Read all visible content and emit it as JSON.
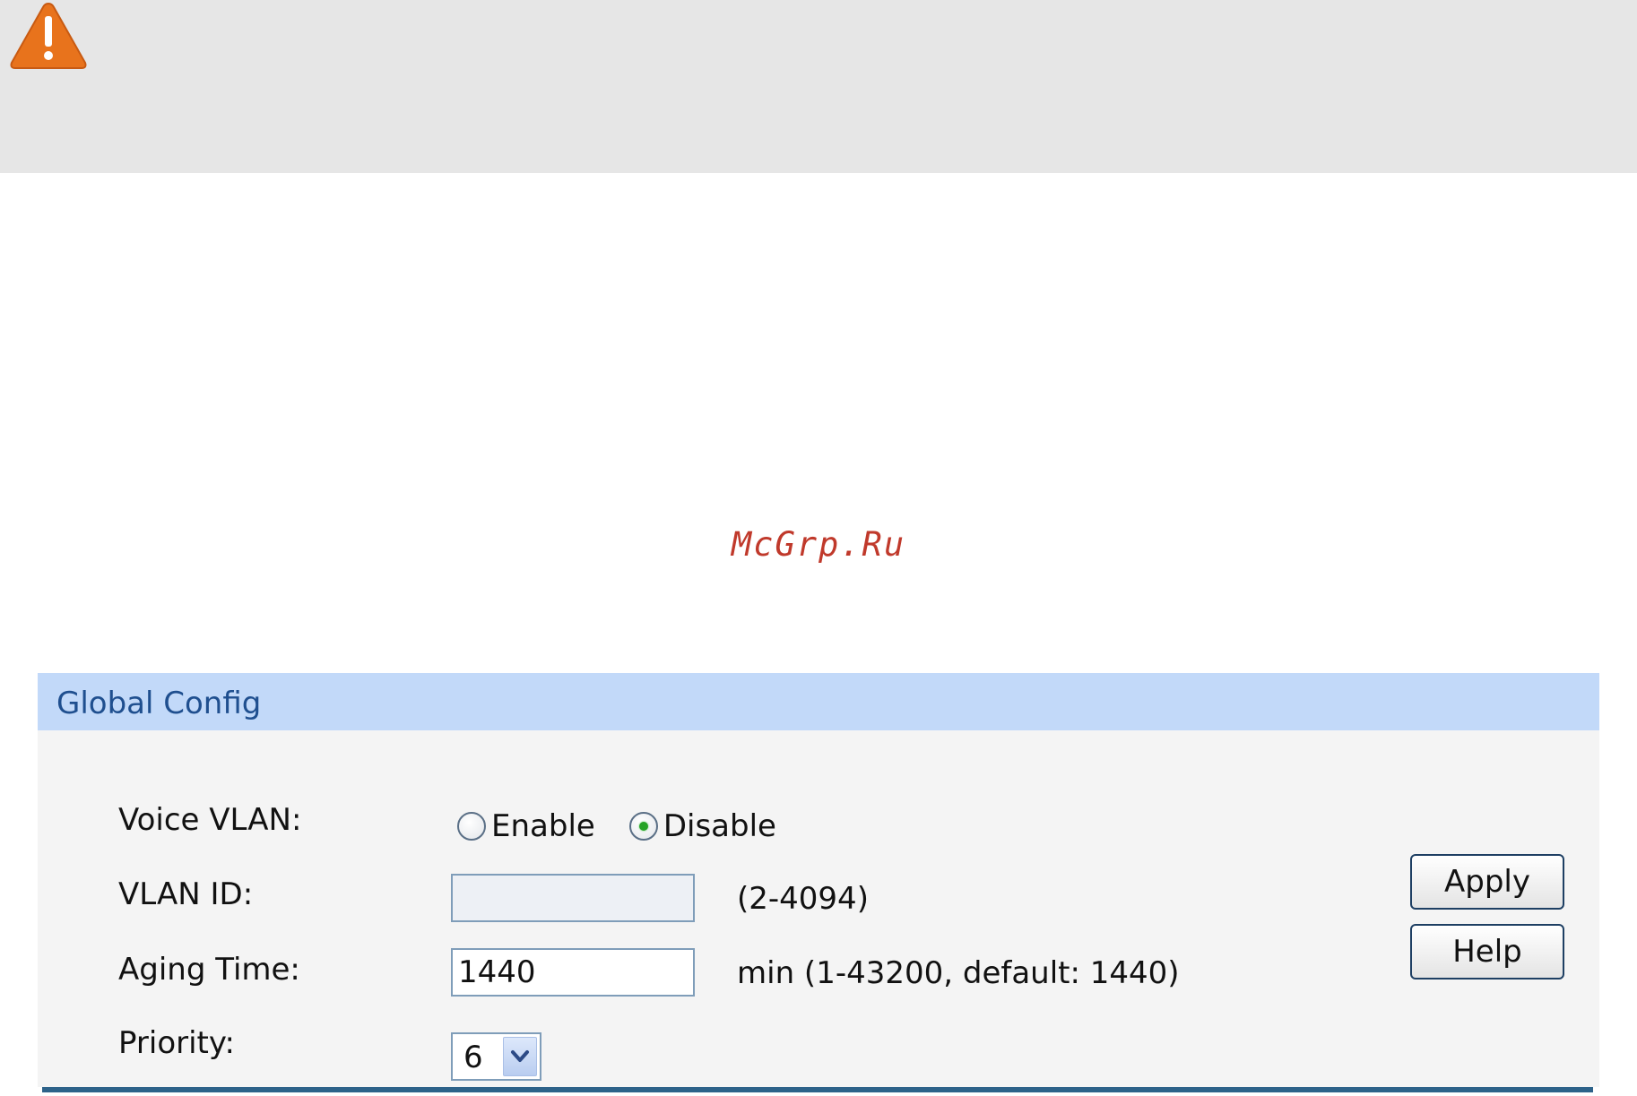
{
  "watermark": {
    "text": "McGrp.Ru"
  },
  "panel": {
    "title": "Global Config"
  },
  "voice_vlan": {
    "label": "Voice VLAN:",
    "options": [
      {
        "label": "Enable",
        "checked": false
      },
      {
        "label": "Disable",
        "checked": true
      }
    ]
  },
  "vlan_id": {
    "label": "VLAN ID:",
    "value": "",
    "hint": "(2-4094)"
  },
  "aging_time": {
    "label": "Aging Time:",
    "value": "1440",
    "hint": "min (1-43200, default: 1440)"
  },
  "priority": {
    "label": "Priority:",
    "selected": "6"
  },
  "buttons": {
    "apply": "Apply",
    "help": "Help"
  },
  "icons": {
    "note": "warning-icon",
    "select_arrow": "chevron-down-icon"
  },
  "colors": {
    "warning": "#e8731c",
    "panel_header": "#c2d9f9",
    "panel_title": "#1f4f8f",
    "footer_bar": "#2d6289",
    "radio_checked": "#25a325"
  }
}
